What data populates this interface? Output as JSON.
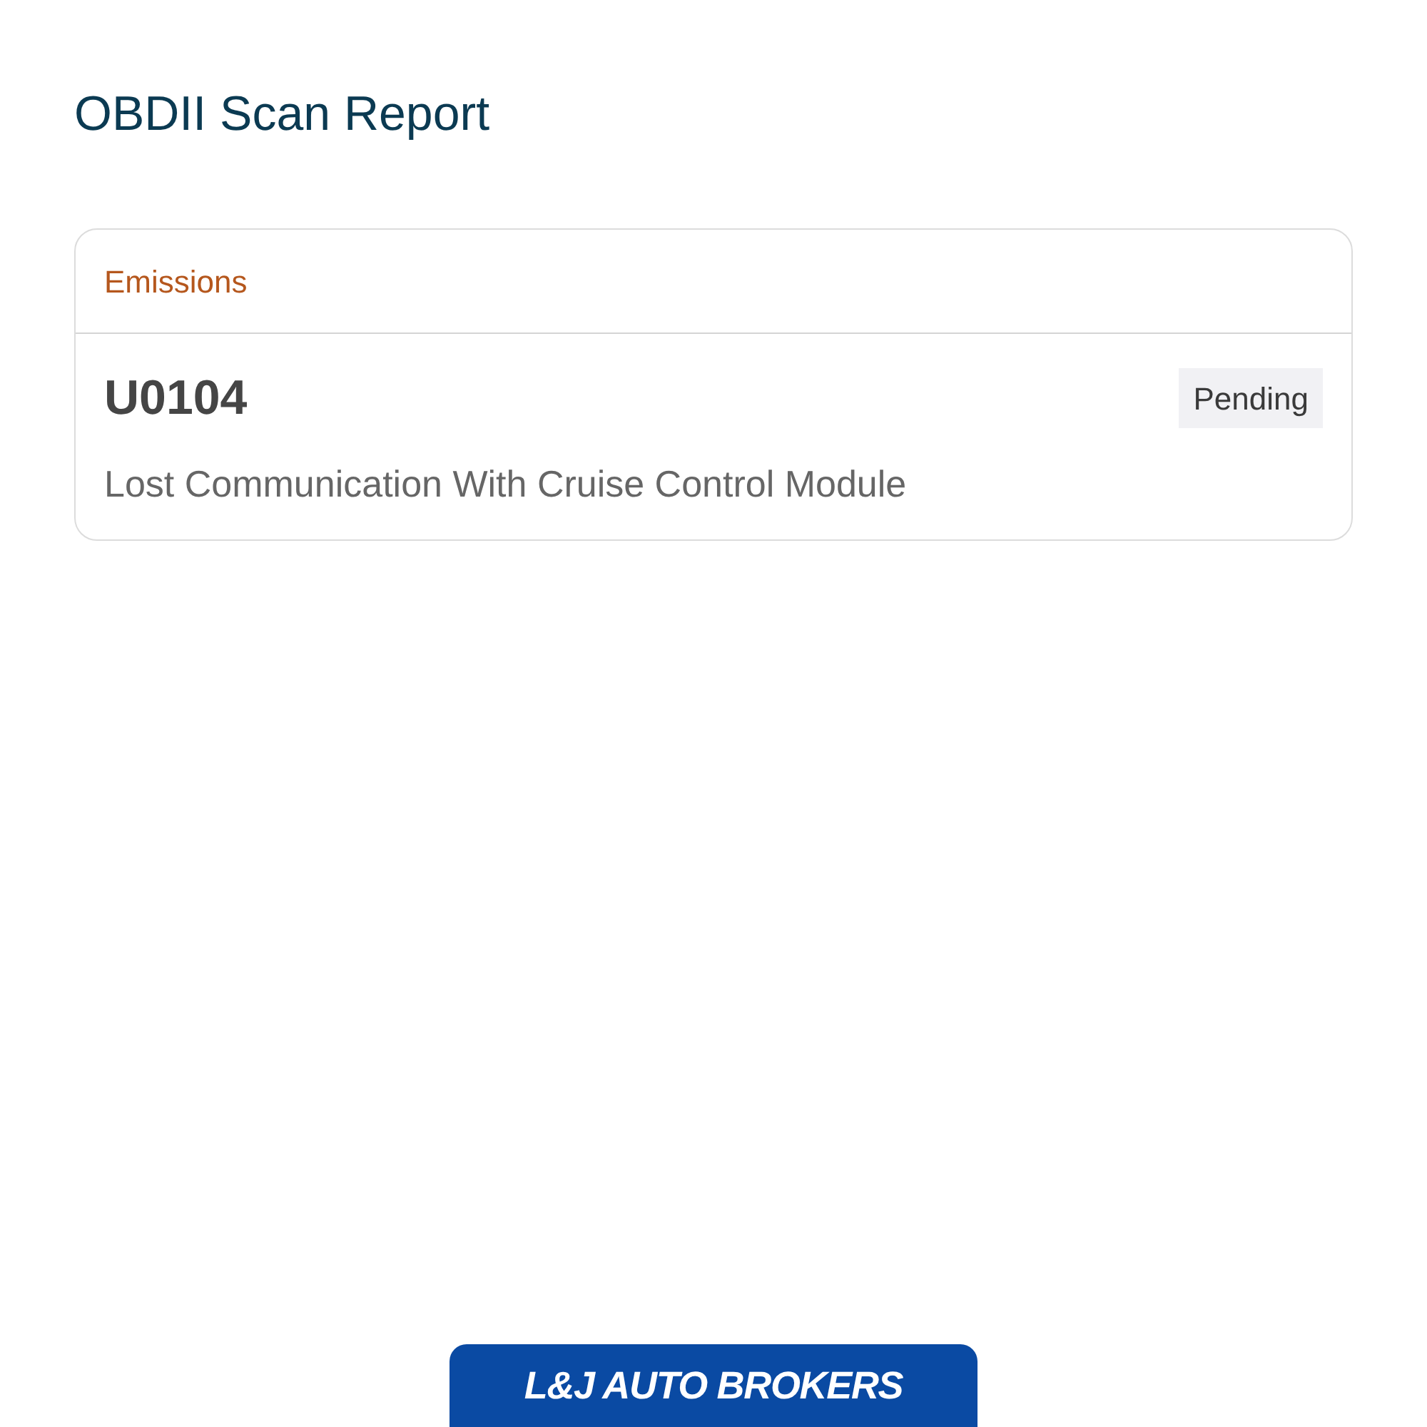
{
  "title": "OBDII Scan Report",
  "codes_card": {
    "category": "Emissions",
    "code": "U0104",
    "status": "Pending",
    "description": "Lost Communication With Cruise Control Module"
  },
  "footer_logo": {
    "text": "L&J AUTO BROKERS"
  }
}
